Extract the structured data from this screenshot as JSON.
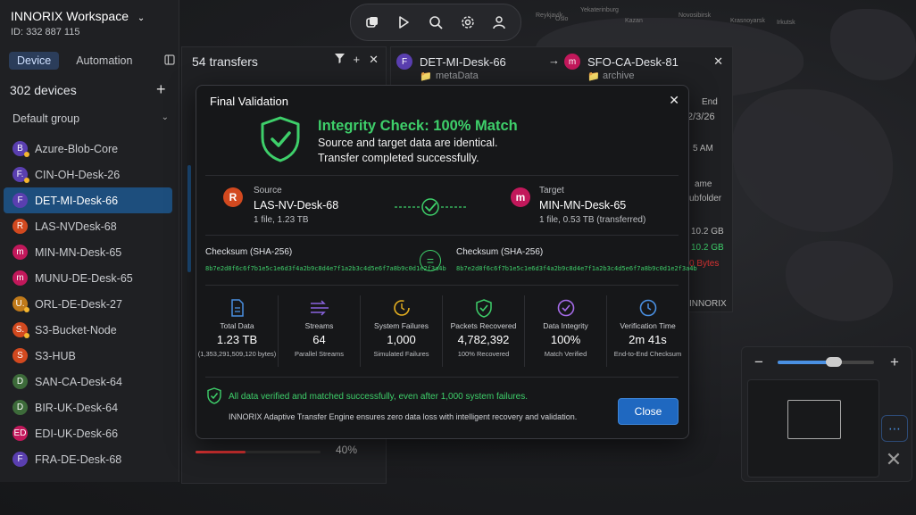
{
  "workspace": {
    "title": "INNORIX Workspace",
    "id": "ID: 332 887 115"
  },
  "left_tabs": {
    "device": "Device",
    "automation": "Automation"
  },
  "devices": {
    "count_label": "302  devices",
    "group": "Default group"
  },
  "device_list": [
    {
      "initial": "B",
      "name": "Azure-Blob-Core",
      "color": "#5a3fb0",
      "status": true
    },
    {
      "initial": "F.",
      "name": "CIN-OH-Desk-26",
      "color": "#5a3fb0",
      "status": true
    },
    {
      "initial": "F",
      "name": "DET-MI-Desk-66",
      "color": "#5a3fb0",
      "status": false
    },
    {
      "initial": "R",
      "name": "LAS-NVDesk-68",
      "color": "#d2491f",
      "status": false
    },
    {
      "initial": "m",
      "name": "MIN-MN-Desk-65",
      "color": "#c2185b",
      "status": false
    },
    {
      "initial": "m",
      "name": "MUNU-DE-Desk-65",
      "color": "#c2185b",
      "status": false
    },
    {
      "initial": "U.",
      "name": "ORL-DE-Desk-27",
      "color": "#c07a1a",
      "status": true
    },
    {
      "initial": "S.",
      "name": "S3-Bucket-Node",
      "color": "#d2491f",
      "status": true
    },
    {
      "initial": "S",
      "name": "S3-HUB",
      "color": "#d2491f",
      "status": false
    },
    {
      "initial": "D",
      "name": "SAN-CA-Desk-64",
      "color": "#3d6b3a",
      "status": false
    },
    {
      "initial": "D",
      "name": "BIR-UK-Desk-64",
      "color": "#3d6b3a",
      "status": false
    },
    {
      "initial": "ED",
      "name": "EDI-UK-Desk-66",
      "color": "#c2185b",
      "status": false
    },
    {
      "initial": "F",
      "name": "FRA-DE-Desk-68",
      "color": "#5a3fb0",
      "status": false
    }
  ],
  "transfers": {
    "count_label": "54  transfers",
    "progress_pct": "40%",
    "progress_fraction": 0.4
  },
  "detail": {
    "source_initial": "F",
    "source_name": "DET-MI-Desk-66",
    "source_folder": "metaData",
    "dest_initial": "m",
    "dest_name": "SFO-CA-Desk-81",
    "dest_folder": "archive",
    "peek_end": "End",
    "peek_date": "2/3/26",
    "peek_am": "5 AM",
    "peek_name": "ame",
    "peek_sub": "ubfolder",
    "peek_gb1": "10.2 GB",
    "peek_gb2": "10.2 GB",
    "peek_bytes": "0 Bytes",
    "peek_brand": "INNORIX"
  },
  "zoom": {
    "level_fraction": 0.58
  },
  "modal": {
    "title": "Final Validation",
    "headline": "Integrity Check: 100% Match",
    "sub1": "Source and target data are identical.",
    "sub2": "Transfer completed successfully.",
    "source": {
      "label": "Source",
      "initial": "R",
      "name": "LAS-NV-Desk-68",
      "info": "1 file, 1.23 TB",
      "color": "#d2491f"
    },
    "target": {
      "label": "Target",
      "initial": "m",
      "name": "MIN-MN-Desk-65",
      "info": "1 file, 0.53 TB (transferred)",
      "color": "#c2185b"
    },
    "checksum_label": "Checksum (SHA-256)",
    "checksum_src": "8b7e2d8f6c6f7b1e5c1e6d3f4a2b9c8d4e7f1a2b3c4d5e6f7a8b9c0d1e2f3a4b",
    "checksum_dst": "8b7e2d8f6c6f7b1e5c1e6d3f4a2b9c8d4e7f1a2b3c4d5e6f7a8b9c0d1e2f3a4b",
    "stats": [
      {
        "label": "Total Data",
        "value": "1.23 TB",
        "foot": "(1,353,291,509,120 bytes)",
        "color": "#4a90e2",
        "icon": "file-icon"
      },
      {
        "label": "Streams",
        "value": "64",
        "foot": "Parallel Streams",
        "color": "#8a63e0",
        "icon": "streams-icon"
      },
      {
        "label": "System Failures",
        "value": "1,000",
        "foot": "Simulated Failures",
        "color": "#e6b020",
        "icon": "refresh-icon"
      },
      {
        "label": "Packets Recovered",
        "value": "4,782,392",
        "foot": "100% Recovered",
        "color": "#3ecf6a",
        "icon": "shield-check-icon"
      },
      {
        "label": "Data Integrity",
        "value": "100%",
        "foot": "Match Verified",
        "color": "#a56be8",
        "icon": "check-circle-icon"
      },
      {
        "label": "Verification Time",
        "value": "2m 41s",
        "foot": "End-to-End Checksum",
        "color": "#4a90e2",
        "icon": "clock-icon"
      }
    ],
    "ok_line": "All data verified and matched successfully, even after 1,000 system failures.",
    "engine_line": "INNORIX Adaptive Transfer Engine ensures zero data loss with intelligent recovery and validation.",
    "close_label": "Close"
  },
  "map_labels": [
    "Reykjavík",
    "Oslo",
    "Kazan",
    "Yekaterinburg",
    "Novosibirsk",
    "Krasnoyarsk",
    "Irkutsk"
  ]
}
